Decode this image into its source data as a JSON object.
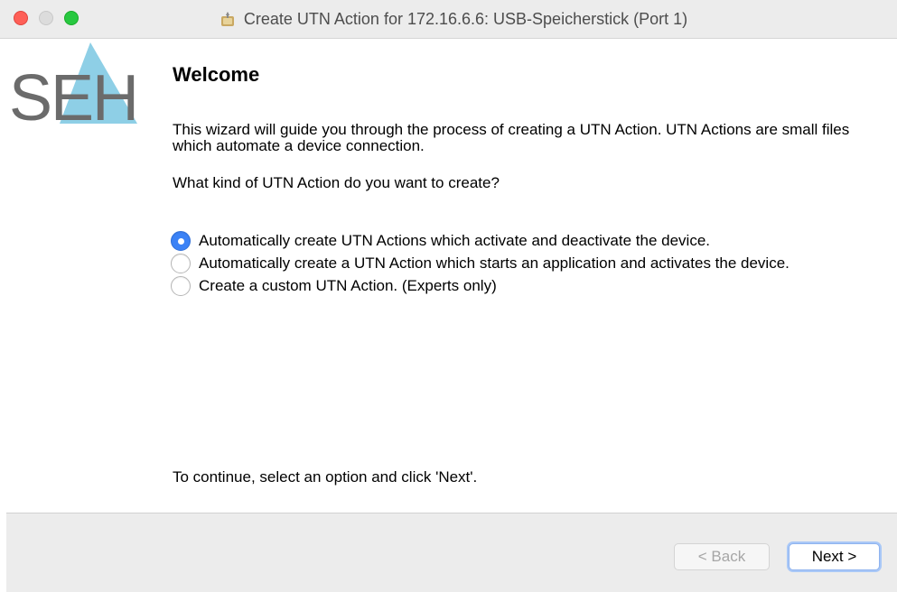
{
  "window": {
    "title": "Create UTN Action for 172.16.6.6: USB-Speicherstick (Port 1)",
    "title_icon": "wizard-icon"
  },
  "logo": {
    "text": "SEH",
    "accent_color": "#7ec8e3",
    "text_color": "#6b6b6b"
  },
  "page": {
    "heading": "Welcome",
    "intro": "This wizard will guide you through the process of creating a UTN Action. UTN Actions are small files which automate a device connection.",
    "question": "What kind of UTN Action do you want to create?",
    "footer_hint": "To continue, select an option and click 'Next'."
  },
  "options": [
    {
      "label": "Automatically create UTN Actions which activate and deactivate the device.",
      "selected": true
    },
    {
      "label": "Automatically create a UTN Action which starts an application and activates the device.",
      "selected": false
    },
    {
      "label": "Create a custom UTN Action. (Experts only)",
      "selected": false
    }
  ],
  "buttons": {
    "back": {
      "label": "< Back",
      "enabled": false
    },
    "next": {
      "label": "Next >",
      "enabled": true
    }
  },
  "colors": {
    "radio_selected": "#3b82f6",
    "focus_ring": "#a9c8f7"
  }
}
